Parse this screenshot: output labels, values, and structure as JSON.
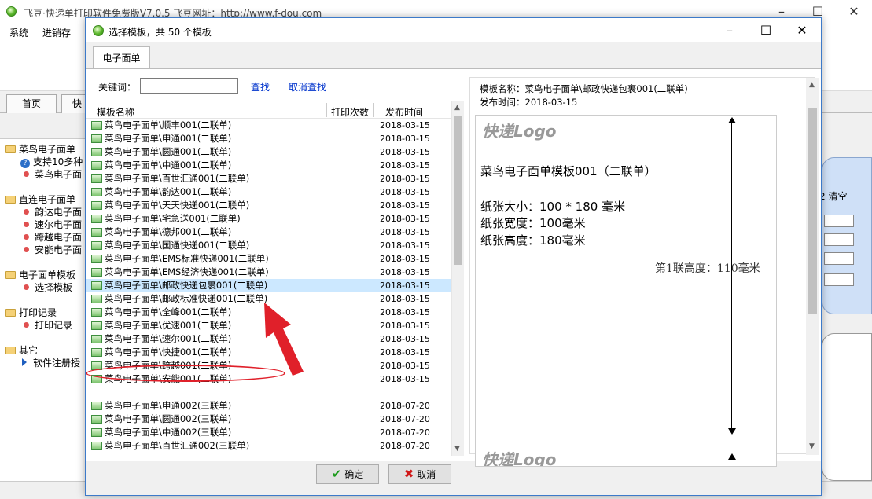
{
  "main_window": {
    "title": "飞豆·快递单打印软件免费版V7.0.5   飞豆网址：http://www.f-dou.com",
    "menu": [
      "系统",
      "进销存"
    ],
    "tabs": [
      "首页",
      "快"
    ],
    "tree": {
      "groups": [
        {
          "label": "菜鸟电子面单",
          "items": [
            "支持10多种",
            "菜鸟电子面"
          ]
        },
        {
          "label": "直连电子面单",
          "items": [
            "韵达电子面",
            "速尔电子面",
            "跨越电子面",
            "安能电子面"
          ]
        },
        {
          "label": "电子面单模板",
          "items": [
            "选择模板"
          ]
        },
        {
          "label": "打印记录",
          "items": [
            "打印记录"
          ]
        },
        {
          "label": "其它",
          "items": [
            "软件注册授"
          ]
        }
      ]
    },
    "right_panel": {
      "clear_label": "2 清空"
    }
  },
  "dialog": {
    "title": "选择模板，共 50 个模板",
    "tab": "电子面单",
    "keyword_label": "关键词：",
    "keyword_value": "",
    "find_label": "查找",
    "cancel_find_label": "取消查找",
    "columns": [
      "模板名称",
      "打印次数",
      "发布时间"
    ],
    "rows": [
      {
        "name": "菜鸟电子面单\\顺丰001(二联单)",
        "date": "2018-03-15"
      },
      {
        "name": "菜鸟电子面单\\申通001(二联单)",
        "date": "2018-03-15"
      },
      {
        "name": "菜鸟电子面单\\圆通001(二联单)",
        "date": "2018-03-15"
      },
      {
        "name": "菜鸟电子面单\\中通001(二联单)",
        "date": "2018-03-15"
      },
      {
        "name": "菜鸟电子面单\\百世汇通001(二联单)",
        "date": "2018-03-15"
      },
      {
        "name": "菜鸟电子面单\\韵达001(二联单)",
        "date": "2018-03-15"
      },
      {
        "name": "菜鸟电子面单\\天天快递001(二联单)",
        "date": "2018-03-15"
      },
      {
        "name": "菜鸟电子面单\\宅急送001(二联单)",
        "date": "2018-03-15"
      },
      {
        "name": "菜鸟电子面单\\德邦001(二联单)",
        "date": "2018-03-15"
      },
      {
        "name": "菜鸟电子面单\\国通快递001(二联单)",
        "date": "2018-03-15"
      },
      {
        "name": "菜鸟电子面单\\EMS标准快递001(二联单)",
        "date": "2018-03-15"
      },
      {
        "name": "菜鸟电子面单\\EMS经济快递001(二联单)",
        "date": "2018-03-15"
      },
      {
        "name": "菜鸟电子面单\\邮政快递包裹001(二联单)",
        "date": "2018-03-15",
        "selected": true
      },
      {
        "name": "菜鸟电子面单\\邮政标准快递001(二联单)",
        "date": "2018-03-15"
      },
      {
        "name": "菜鸟电子面单\\全峰001(二联单)",
        "date": "2018-03-15"
      },
      {
        "name": "菜鸟电子面单\\优速001(二联单)",
        "date": "2018-03-15"
      },
      {
        "name": "菜鸟电子面单\\速尔001(二联单)",
        "date": "2018-03-15"
      },
      {
        "name": "菜鸟电子面单\\快捷001(二联单)",
        "date": "2018-03-15"
      },
      {
        "name": "菜鸟电子面单\\跨越001(二联单)",
        "date": "2018-03-15"
      },
      {
        "name": "菜鸟电子面单\\安能001(二联单)",
        "date": "2018-03-15"
      },
      {
        "name": "菜鸟电子面单\\申通002(三联单)",
        "date": "2018-07-20"
      },
      {
        "name": "菜鸟电子面单\\圆通002(三联单)",
        "date": "2018-07-20"
      },
      {
        "name": "菜鸟电子面单\\中通002(三联单)",
        "date": "2018-07-20"
      },
      {
        "name": "菜鸟电子面单\\百世汇通002(三联单)",
        "date": "2018-07-20"
      }
    ],
    "preview": {
      "name_line": "模板名称：菜鸟电子面单\\邮政快递包裹001(二联单)",
      "date_line": "发布时间：2018-03-15",
      "logo": "快递Logo",
      "template_title": "菜鸟电子面单模板001（二联单）",
      "paper_size": "纸张大小：100 * 180 毫米",
      "paper_width": "纸张宽度：100毫米",
      "paper_height": "纸张高度：180毫米",
      "first_part_height": "第1联高度：110毫米"
    },
    "ok_label": "确定",
    "cancel_label": "取消"
  },
  "colors": {
    "selected_row": "#cce8ff",
    "link": "#0033cc",
    "annotation": "#e0202a",
    "dialog_border": "#3c7ac9"
  }
}
